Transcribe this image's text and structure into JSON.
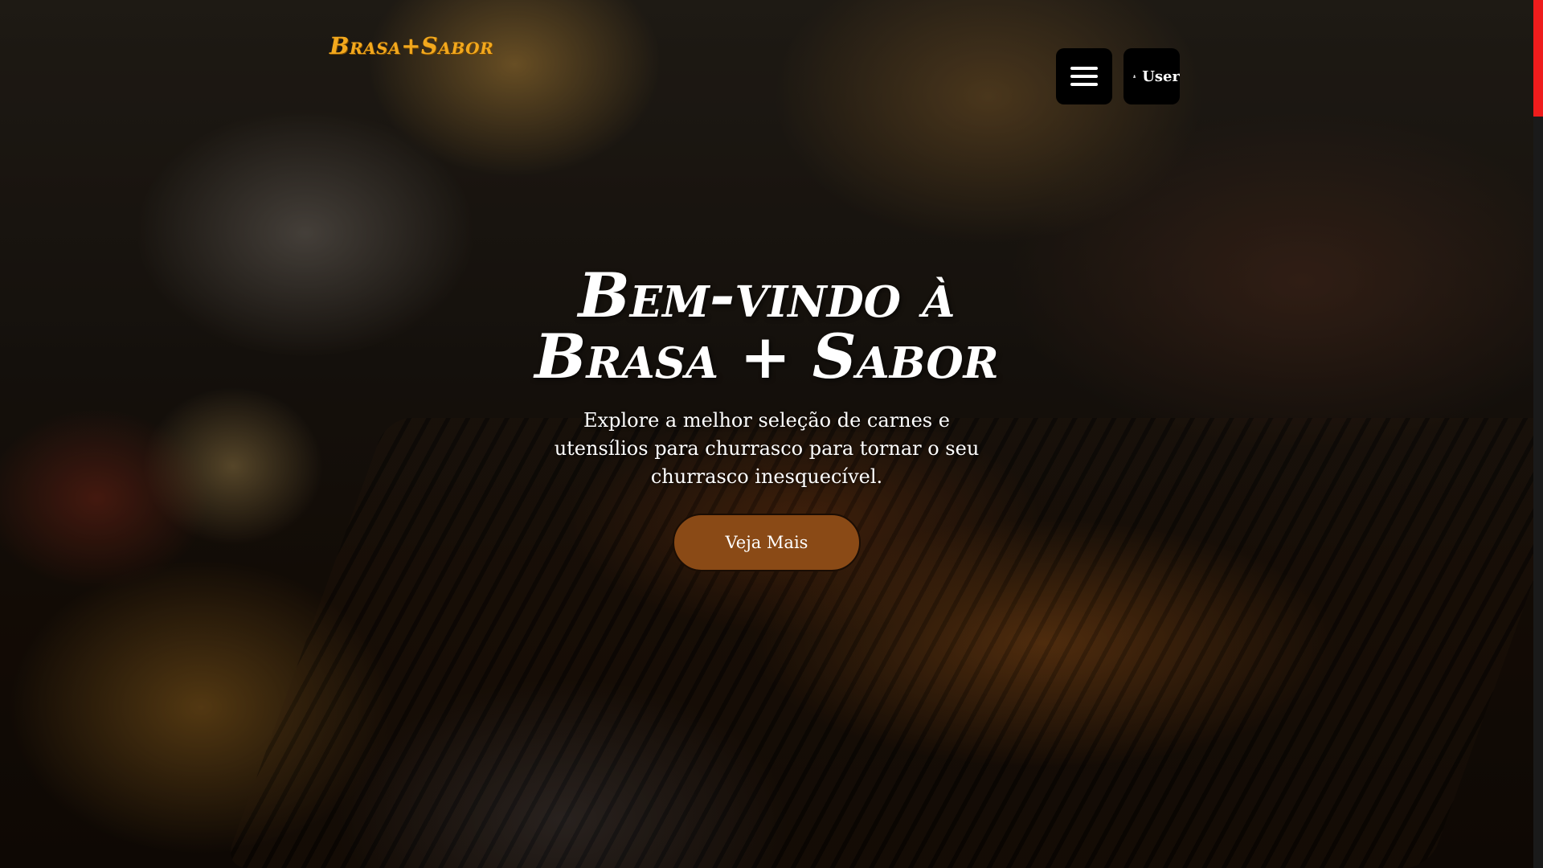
{
  "header": {
    "logo_text": "Brasa+Sabor",
    "menu_icon": "hamburger-menu-icon",
    "user_icon": "user-icon",
    "user_label": "User"
  },
  "hero": {
    "title": "Bem-vindo à Brasa + Sabor",
    "subtitle": "Explore a melhor seleção de carnes e utensílios para churrasco para tornar o seu churrasco inesquecível.",
    "cta_label": "Veja Mais"
  },
  "colors": {
    "logo": "#f2a81d",
    "cta_background": "#8a4a16",
    "scrollbar_thumb": "#ee1c1c",
    "nav_button_background": "#000000"
  }
}
